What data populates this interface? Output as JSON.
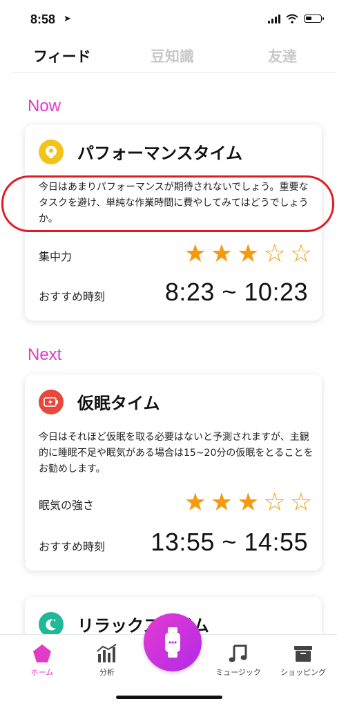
{
  "status_bar": {
    "time": "8:58"
  },
  "tabs": [
    {
      "label": "フィード",
      "active": true
    },
    {
      "label": "豆知識",
      "active": false
    },
    {
      "label": "友達",
      "active": false
    }
  ],
  "sections": {
    "now": {
      "label": "Now"
    },
    "next": {
      "label": "Next"
    }
  },
  "cards": [
    {
      "title": "パフォーマンスタイム",
      "icon": "lightbulb-head-icon",
      "icon_color": "#f3c31a",
      "description": "今日はあまりパフォーマンスが期待されないでしょう。重要なタスクを避け、単純な作業時間に費やしてみてはどうでしょうか。",
      "rating_label": "集中力",
      "rating": 3,
      "rating_max": 5,
      "time_label": "おすすめ時刻",
      "time_range": "8:23 ~ 10:23"
    },
    {
      "title": "仮眠タイム",
      "icon": "battery-charge-icon",
      "icon_color": "#e5483c",
      "description": "今日はそれほど仮眠を取る必要はないと予測されますが、主観的に睡眠不足や眠気がある場合は15~20分の仮眠をとることをお勧めします。",
      "rating_label": "眠気の強さ",
      "rating": 3,
      "rating_max": 5,
      "time_label": "おすすめ時刻",
      "time_range": "13:55 ~ 14:55"
    },
    {
      "title": "リラックスタイム",
      "icon": "moon-stars-icon",
      "icon_color": "#1fb99a"
    }
  ],
  "bottom_nav": [
    {
      "label": "ホーム",
      "icon": "home-pentagon-icon",
      "active": true
    },
    {
      "label": "分析",
      "icon": "chart-icon",
      "active": false
    },
    {
      "label": "ミュージック",
      "icon": "music-note-icon",
      "active": false
    },
    {
      "label": "ショッピング",
      "icon": "shopping-box-icon",
      "active": false
    }
  ],
  "center_button": {
    "icon": "watch-icon"
  },
  "colors": {
    "accent": "#e23bc6",
    "star": "#f59a0c",
    "highlight": "#e01b24"
  }
}
